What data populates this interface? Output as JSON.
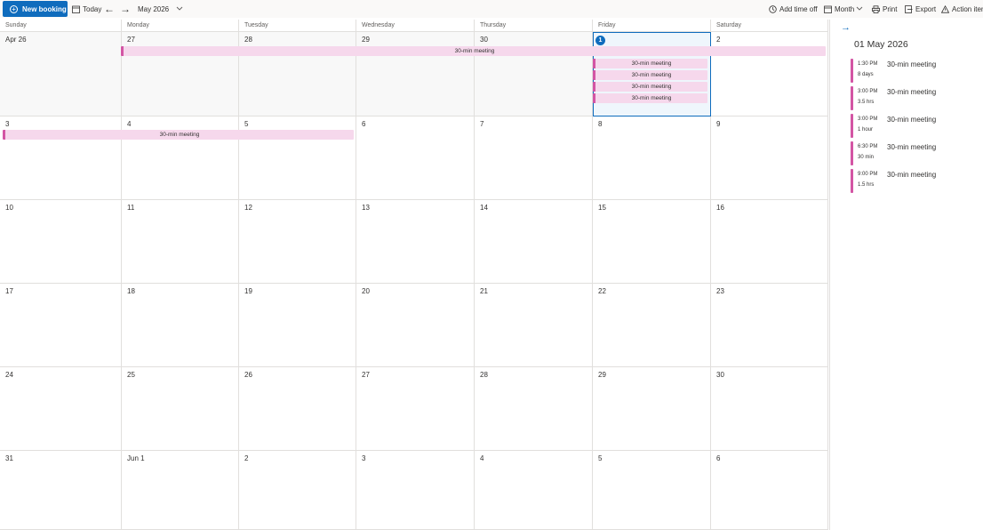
{
  "toolbar": {
    "new_booking": "New booking",
    "today": "Today",
    "month_label": "May 2026",
    "add_time_off": "Add time off",
    "view": "Month",
    "print": "Print",
    "export": "Export",
    "action_items": "Action item"
  },
  "weekdays": [
    "Sunday",
    "Monday",
    "Tuesday",
    "Wednesday",
    "Thursday",
    "Friday",
    "Saturday"
  ],
  "weeks": [
    [
      "Apr 26",
      "27",
      "28",
      "29",
      "30",
      "1",
      "2"
    ],
    [
      "3",
      "4",
      "5",
      "6",
      "7",
      "8",
      "9"
    ],
    [
      "10",
      "11",
      "12",
      "13",
      "14",
      "15",
      "16"
    ],
    [
      "17",
      "18",
      "19",
      "20",
      "21",
      "22",
      "23"
    ],
    [
      "24",
      "25",
      "26",
      "27",
      "28",
      "29",
      "30"
    ],
    [
      "31",
      "Jun 1",
      "2",
      "3",
      "4",
      "5",
      "6"
    ]
  ],
  "events": {
    "multiday_1": "30-min meeting",
    "multiday_2": "30-min meeting",
    "friday": [
      "30-min meeting",
      "30-min meeting",
      "30-min meeting",
      "30-min meeting"
    ]
  },
  "panel": {
    "date_title": "01 May 2026",
    "items": [
      {
        "time": "1:30 PM",
        "duration": "8 days",
        "title": "30-min meeting"
      },
      {
        "time": "3:00 PM",
        "duration": "3.5 hrs",
        "title": "30-min meeting"
      },
      {
        "time": "3:00 PM",
        "duration": "1 hour",
        "title": "30-min meeting"
      },
      {
        "time": "6:30 PM",
        "duration": "30 min",
        "title": "30-min meeting"
      },
      {
        "time": "9:00 PM",
        "duration": "1.5 hrs",
        "title": "30-min meeting"
      }
    ]
  },
  "colors": {
    "accent": "#0f6cbd",
    "event_bg": "#f6d8ec",
    "event_border": "#d355a4"
  }
}
